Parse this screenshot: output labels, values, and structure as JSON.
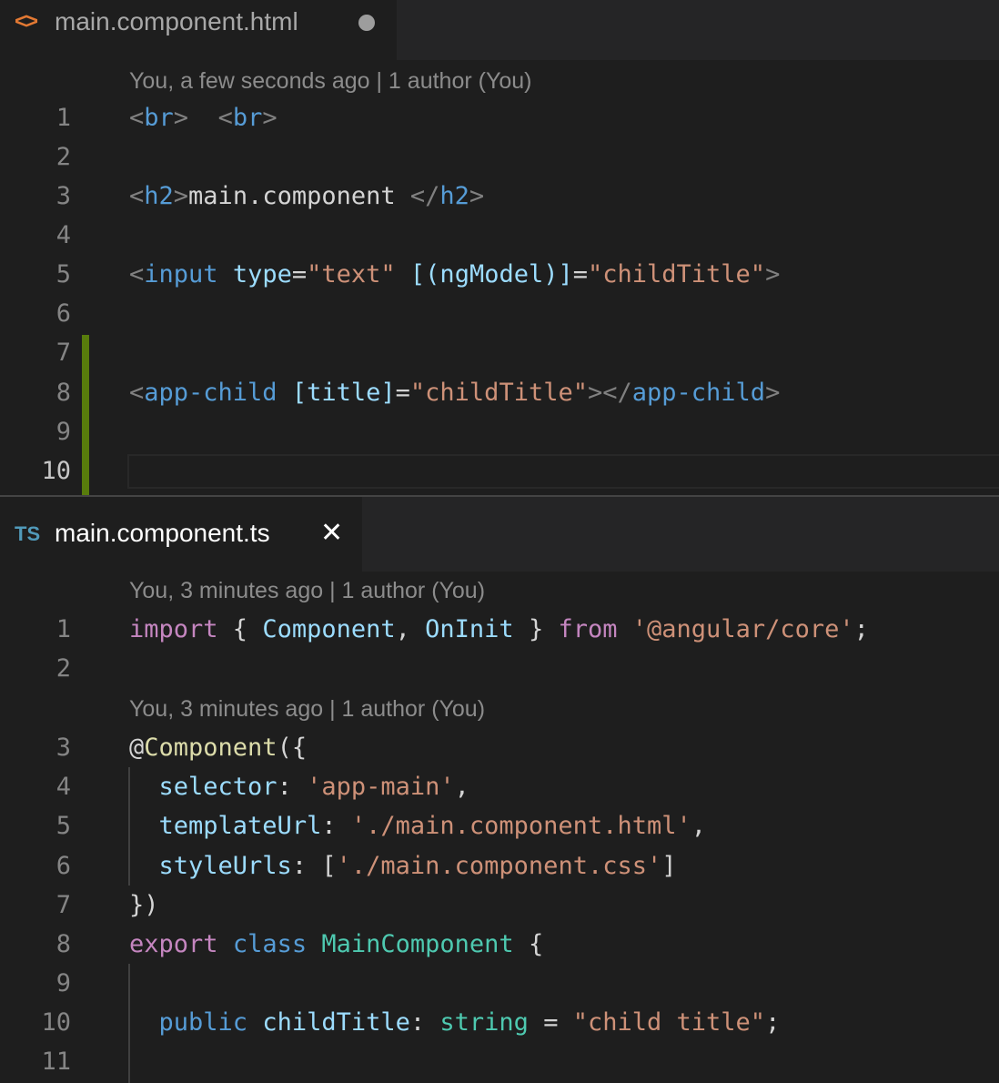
{
  "top_editor": {
    "tab": {
      "icon": "html-code-icon",
      "icon_glyph": "<>",
      "title": "main.component.html",
      "modified": true
    },
    "codelens": "You, a few seconds ago | 1 author (You)",
    "active_line": 10,
    "lines": [
      {
        "number": "1",
        "tokens": [
          {
            "t": "<",
            "c": "punct"
          },
          {
            "t": "br",
            "c": "tag"
          },
          {
            "t": ">",
            "c": "punct"
          },
          {
            "t": "  ",
            "c": "text"
          },
          {
            "t": "<",
            "c": "punct"
          },
          {
            "t": "br",
            "c": "tag"
          },
          {
            "t": ">",
            "c": "punct"
          }
        ]
      },
      {
        "number": "2",
        "tokens": []
      },
      {
        "number": "3",
        "tokens": [
          {
            "t": "<",
            "c": "punct"
          },
          {
            "t": "h2",
            "c": "tag"
          },
          {
            "t": ">",
            "c": "punct"
          },
          {
            "t": "main.component ",
            "c": "text"
          },
          {
            "t": "</",
            "c": "punct"
          },
          {
            "t": "h2",
            "c": "tag"
          },
          {
            "t": ">",
            "c": "punct"
          }
        ]
      },
      {
        "number": "4",
        "tokens": []
      },
      {
        "number": "5",
        "tokens": [
          {
            "t": "<",
            "c": "punct"
          },
          {
            "t": "input",
            "c": "tag"
          },
          {
            "t": " ",
            "c": "text"
          },
          {
            "t": "type",
            "c": "attr"
          },
          {
            "t": "=",
            "c": "text"
          },
          {
            "t": "\"text\"",
            "c": "str"
          },
          {
            "t": " ",
            "c": "text"
          },
          {
            "t": "[(ngModel)]",
            "c": "attr"
          },
          {
            "t": "=",
            "c": "text"
          },
          {
            "t": "\"childTitle\"",
            "c": "str"
          },
          {
            "t": ">",
            "c": "punct"
          }
        ]
      },
      {
        "number": "6",
        "tokens": []
      },
      {
        "number": "7",
        "tokens": []
      },
      {
        "number": "8",
        "tokens": [
          {
            "t": "<",
            "c": "punct"
          },
          {
            "t": "app-child",
            "c": "tag"
          },
          {
            "t": " ",
            "c": "text"
          },
          {
            "t": "[title]",
            "c": "attr"
          },
          {
            "t": "=",
            "c": "text"
          },
          {
            "t": "\"childTitle\"",
            "c": "str"
          },
          {
            "t": "></",
            "c": "punct"
          },
          {
            "t": "app-child",
            "c": "tag"
          },
          {
            "t": ">",
            "c": "punct"
          }
        ]
      },
      {
        "number": "9",
        "tokens": []
      },
      {
        "number": "10",
        "tokens": []
      }
    ]
  },
  "bottom_editor": {
    "tab": {
      "icon": "typescript-icon",
      "icon_glyph": "TS",
      "title": "main.component.ts",
      "close_glyph": "✕"
    },
    "codelens": [
      "You, 3 minutes ago | 1 author (You)",
      "You, 3 minutes ago | 1 author (You)"
    ],
    "lines": [
      {
        "number": "1",
        "tokens": [
          {
            "t": "import",
            "c": "kw"
          },
          {
            "t": " { ",
            "c": "text"
          },
          {
            "t": "Component",
            "c": "var"
          },
          {
            "t": ", ",
            "c": "text"
          },
          {
            "t": "OnInit",
            "c": "var"
          },
          {
            "t": " } ",
            "c": "text"
          },
          {
            "t": "from",
            "c": "kw"
          },
          {
            "t": " ",
            "c": "text"
          },
          {
            "t": "'@angular/core'",
            "c": "str"
          },
          {
            "t": ";",
            "c": "text"
          }
        ]
      },
      {
        "number": "2",
        "tokens": []
      },
      {
        "number": "3",
        "tokens": [
          {
            "t": "@",
            "c": "text"
          },
          {
            "t": "Component",
            "c": "fn"
          },
          {
            "t": "({",
            "c": "text"
          }
        ]
      },
      {
        "number": "4",
        "tokens": [
          {
            "t": "  ",
            "c": "text"
          },
          {
            "t": "selector",
            "c": "var"
          },
          {
            "t": ": ",
            "c": "text"
          },
          {
            "t": "'app-main'",
            "c": "str"
          },
          {
            "t": ",",
            "c": "text"
          }
        ]
      },
      {
        "number": "5",
        "tokens": [
          {
            "t": "  ",
            "c": "text"
          },
          {
            "t": "templateUrl",
            "c": "var"
          },
          {
            "t": ": ",
            "c": "text"
          },
          {
            "t": "'./main.component.html'",
            "c": "str"
          },
          {
            "t": ",",
            "c": "text"
          }
        ]
      },
      {
        "number": "6",
        "tokens": [
          {
            "t": "  ",
            "c": "text"
          },
          {
            "t": "styleUrls",
            "c": "var"
          },
          {
            "t": ": [",
            "c": "text"
          },
          {
            "t": "'./main.component.css'",
            "c": "str"
          },
          {
            "t": "]",
            "c": "text"
          }
        ]
      },
      {
        "number": "7",
        "tokens": [
          {
            "t": "})",
            "c": "text"
          }
        ]
      },
      {
        "number": "8",
        "tokens": [
          {
            "t": "export",
            "c": "kw"
          },
          {
            "t": " ",
            "c": "text"
          },
          {
            "t": "class",
            "c": "kw2"
          },
          {
            "t": " ",
            "c": "text"
          },
          {
            "t": "MainComponent",
            "c": "type"
          },
          {
            "t": " {",
            "c": "text"
          }
        ]
      },
      {
        "number": "9",
        "tokens": []
      },
      {
        "number": "10",
        "tokens": [
          {
            "t": "  ",
            "c": "text"
          },
          {
            "t": "public",
            "c": "kw2"
          },
          {
            "t": " ",
            "c": "text"
          },
          {
            "t": "childTitle",
            "c": "var"
          },
          {
            "t": ": ",
            "c": "text"
          },
          {
            "t": "string",
            "c": "type"
          },
          {
            "t": " = ",
            "c": "text"
          },
          {
            "t": "\"child title\"",
            "c": "str"
          },
          {
            "t": ";",
            "c": "text"
          }
        ]
      },
      {
        "number": "11",
        "tokens": []
      }
    ]
  }
}
